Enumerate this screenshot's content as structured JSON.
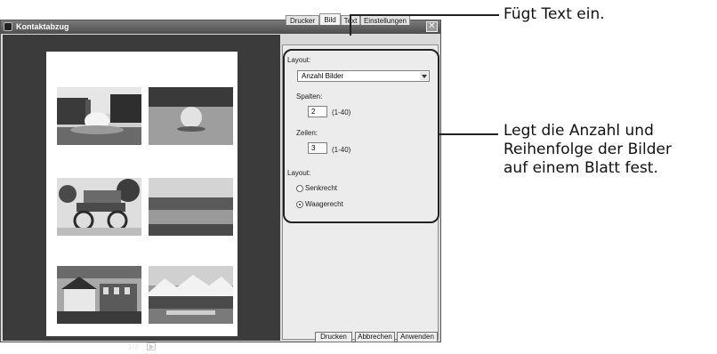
{
  "window": {
    "title": "Kontaktabzug",
    "close_glyph": "✕"
  },
  "preview": {
    "page_indicator": "1/2",
    "next_icon": "play-triangle-icon",
    "thumbnails": [
      "fountain-photo",
      "stone-ball-photo",
      "wagon-photo",
      "river-photo",
      "village-photo",
      "lake-mountains-photo"
    ]
  },
  "tabs": [
    {
      "label": "Drucker"
    },
    {
      "label": "Bild"
    },
    {
      "label": "Text"
    },
    {
      "label": "Einstellungen"
    }
  ],
  "settings": {
    "layout_label": "Layout:",
    "layout_select_value": "Anzahl Bilder",
    "columns_label": "Spalten:",
    "columns_value": "2",
    "columns_range": "(1-40)",
    "rows_label": "Zeilen:",
    "rows_value": "3",
    "rows_range": "(1-40)",
    "orientation_label": "Layout:",
    "orientation_options": [
      {
        "label": "Senkrecht",
        "selected": false
      },
      {
        "label": "Waagerecht",
        "selected": true
      }
    ]
  },
  "buttons": {
    "print": "Drucken",
    "cancel": "Abbrechen",
    "apply": "Anwenden"
  },
  "callouts": {
    "text_tab": "Fügt Text ein.",
    "layout_lines": [
      "Legt die Anzahl und",
      "Reihenfolge der Bilder",
      "auf einem Blatt fest."
    ]
  },
  "colors": {
    "titlebar": "#5a5a5a",
    "preview_bg": "#3b3b3b",
    "panel_bg": "#ececec",
    "callout": "#222222"
  }
}
